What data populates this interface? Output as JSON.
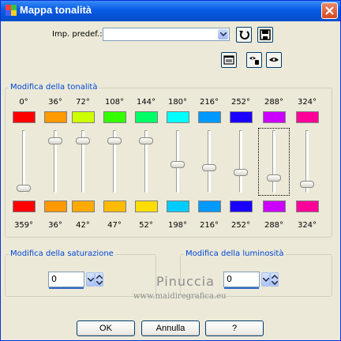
{
  "window": {
    "title": "Mappa tonalità"
  },
  "preset": {
    "label": "Imp. predef.:",
    "value": ""
  },
  "hue_group": {
    "title": "Modifica della tonalità",
    "sliders": [
      {
        "top_label": "0°",
        "bottom_label": "359°",
        "top_color": "#ff0000",
        "bottom_color": "#ff0000",
        "level": 0.0
      },
      {
        "top_label": "36°",
        "bottom_label": "36°",
        "top_color": "#ff9900",
        "bottom_color": "#ff9900",
        "level": 0.5
      },
      {
        "top_label": "72°",
        "bottom_label": "42°",
        "top_color": "#ccff00",
        "bottom_color": "#ffaa00",
        "level": 0.5
      },
      {
        "top_label": "108°",
        "bottom_label": "47°",
        "top_color": "#33ff00",
        "bottom_color": "#ffbb00",
        "level": 0.5
      },
      {
        "top_label": "144°",
        "bottom_label": "52°",
        "top_color": "#00ff66",
        "bottom_color": "#ffdd00",
        "level": 0.5
      },
      {
        "top_label": "180°",
        "bottom_label": "198°",
        "top_color": "#00ffff",
        "bottom_color": "#00ccff",
        "level": 0.5
      },
      {
        "top_label": "216°",
        "bottom_label": "216°",
        "top_color": "#0099ff",
        "bottom_color": "#0099ff",
        "level": 0.5
      },
      {
        "top_label": "252°",
        "bottom_label": "252°",
        "top_color": "#1a00ff",
        "bottom_color": "#1a00ff",
        "level": 0.5
      },
      {
        "top_label": "288°",
        "bottom_label": "288°",
        "top_color": "#cc00ff",
        "bottom_color": "#cc00ff",
        "level": 0.5
      },
      {
        "top_label": "324°",
        "bottom_label": "324°",
        "top_color": "#ff0099",
        "bottom_color": "#ff0099",
        "level": 0.5
      }
    ]
  },
  "saturation": {
    "title": "Modifica della saturazione",
    "value": "0"
  },
  "luminosity": {
    "title": "Modifica della luminosità",
    "value": "0"
  },
  "watermark": {
    "line1": "Pinuccia",
    "line2": "www.maidiregrafica.eu"
  },
  "buttons": {
    "ok": "OK",
    "cancel": "Annulla",
    "help": "?"
  },
  "icons": {
    "title": "hue-map-icon",
    "close": "close-icon",
    "dropdown": "chevron-down-icon",
    "reset": "reset-arrow-icon",
    "save": "floppy-disk-icon",
    "preview": "preview-window-icon",
    "proof": "hand-eye-icon",
    "eye": "eye-icon"
  }
}
